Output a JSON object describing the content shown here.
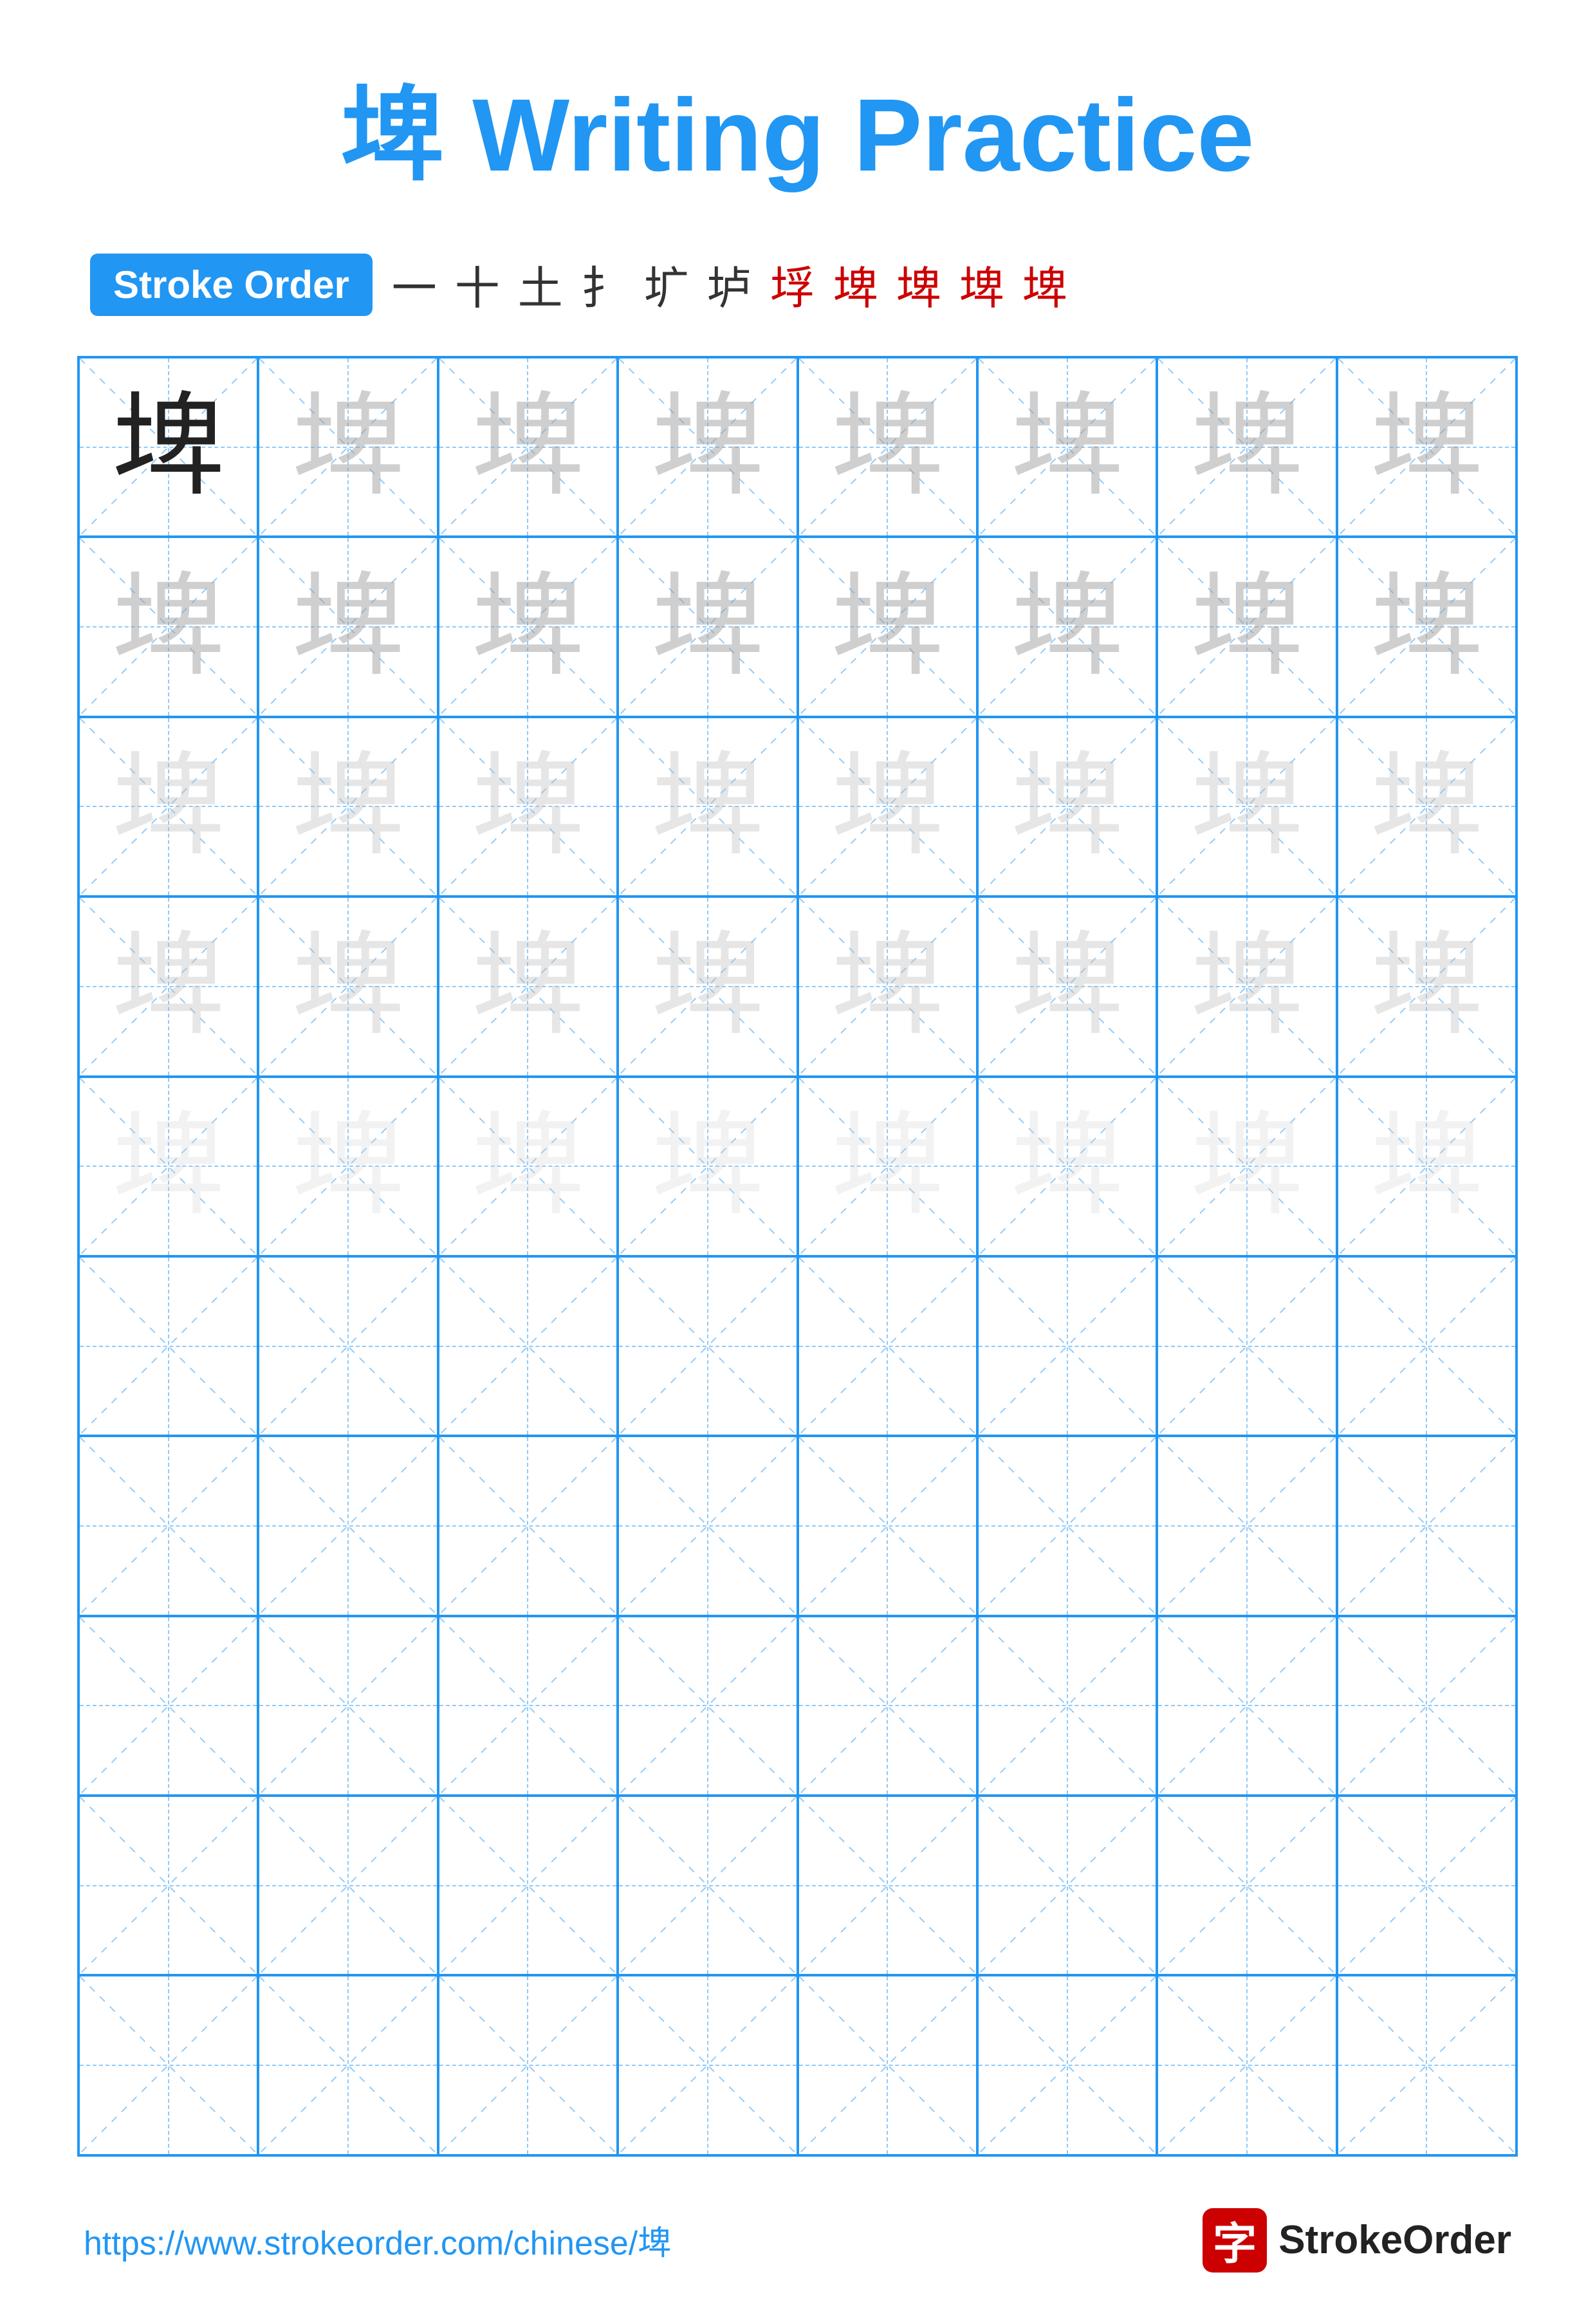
{
  "title": {
    "char": "埤",
    "label": "Writing Practice",
    "full": "埤 Writing Practice"
  },
  "stroke_order": {
    "badge_label": "Stroke Order",
    "steps": [
      "一",
      "十",
      "土",
      "扌",
      "圹",
      "垆",
      "垺",
      "埤",
      "埤",
      "埤",
      "埤"
    ]
  },
  "grid": {
    "cols": 8,
    "rows": 10,
    "char": "埤",
    "row_types": [
      "solid_guide",
      "guide",
      "lighter",
      "lighter",
      "lightest",
      "empty",
      "empty",
      "empty",
      "empty",
      "empty"
    ]
  },
  "footer": {
    "url": "https://www.strokeorder.com/chinese/埤",
    "brand_char": "字",
    "brand_name": "StrokeOrder"
  }
}
